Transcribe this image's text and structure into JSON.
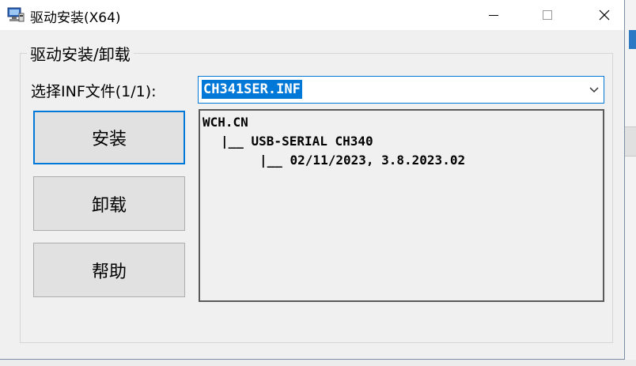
{
  "window": {
    "title": "驱动安装(X64)",
    "icons": {
      "app": "usb-driver-icon",
      "minimize": "minimize-icon",
      "maximize": "maximize-icon",
      "close": "close-icon"
    }
  },
  "group": {
    "label": "驱动安装/卸载"
  },
  "inf_selector": {
    "label": "选择INF文件(1/1):",
    "value": "CH341SER.INF",
    "icon": "chevron-down-icon"
  },
  "buttons": {
    "install": "安装",
    "uninstall": "卸载",
    "help": "帮助"
  },
  "driver_info": {
    "lines": [
      "WCH.CN",
      "|__ USB-SERIAL CH340",
      "|__ 02/11/2023, 3.8.2023.02"
    ]
  },
  "colors": {
    "accent": "#0078d7",
    "window_bg": "#f0f0f0",
    "button_bg": "#e1e1e1"
  }
}
